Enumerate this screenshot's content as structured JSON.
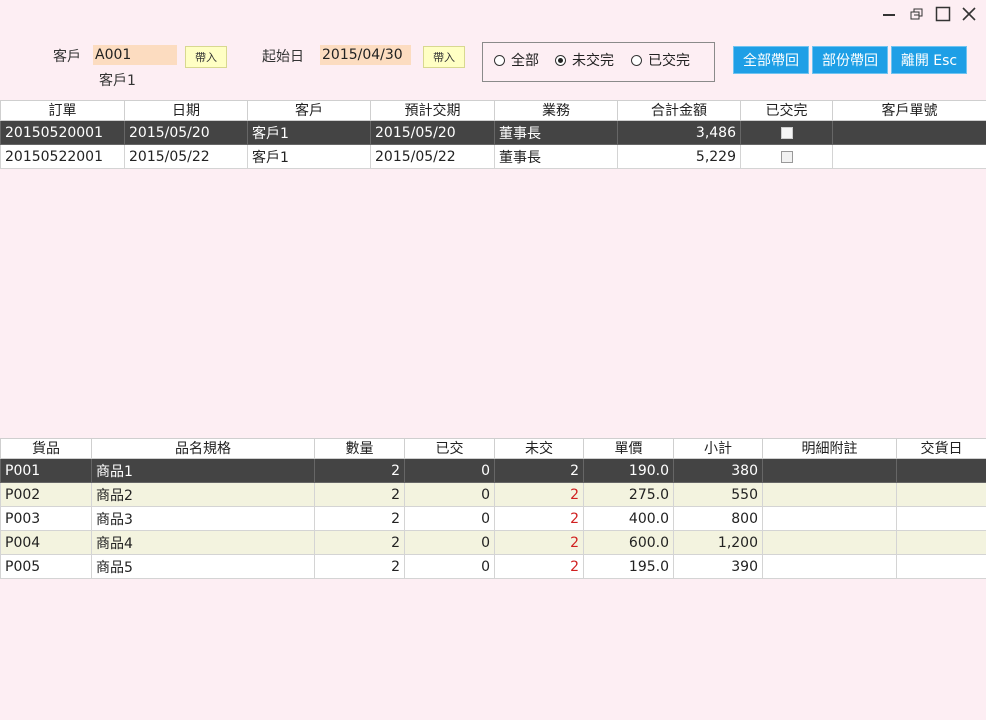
{
  "window": {
    "minimize_icon": "minimize-icon",
    "restore_icon": "restore-icon",
    "maximize_icon": "maximize-icon",
    "close_icon": "close-icon"
  },
  "filter": {
    "customer_label": "客戶",
    "customer_code": "A001",
    "customer_name": "客戶1",
    "import_label": "帶入",
    "start_date_label": "起始日",
    "start_date": "2015/04/30",
    "radios": [
      {
        "label": "全部",
        "selected": false
      },
      {
        "label": "未交完",
        "selected": true
      },
      {
        "label": "已交完",
        "selected": false
      }
    ]
  },
  "actions": {
    "return_all": "全部帶回",
    "return_partial": "部份帶回",
    "exit": "離開 Esc"
  },
  "orders": {
    "columns": [
      "訂單",
      "日期",
      "客戶",
      "預計交期",
      "業務",
      "合計金額",
      "已交完",
      "客戶單號"
    ],
    "rows": [
      {
        "order": "20150520001",
        "date": "2015/05/20",
        "customer": "客戶1",
        "due": "2015/05/20",
        "sales": "董事長",
        "total": "3,486",
        "done": false,
        "cust_no": ""
      },
      {
        "order": "20150522001",
        "date": "2015/05/22",
        "customer": "客戶1",
        "due": "2015/05/22",
        "sales": "董事長",
        "total": "5,229",
        "done": false,
        "cust_no": ""
      }
    ]
  },
  "details": {
    "columns": [
      "貨品",
      "品名規格",
      "數量",
      "已交",
      "未交",
      "單價",
      "小計",
      "明細附註",
      "交貨日"
    ],
    "rows": [
      {
        "code": "P001",
        "name": "商品1",
        "qty": "2",
        "delivered": "0",
        "pending": "2",
        "price": "190.0",
        "subtotal": "380",
        "note": "",
        "date": ""
      },
      {
        "code": "P002",
        "name": "商品2",
        "qty": "2",
        "delivered": "0",
        "pending": "2",
        "price": "275.0",
        "subtotal": "550",
        "note": "",
        "date": ""
      },
      {
        "code": "P003",
        "name": "商品3",
        "qty": "2",
        "delivered": "0",
        "pending": "2",
        "price": "400.0",
        "subtotal": "800",
        "note": "",
        "date": ""
      },
      {
        "code": "P004",
        "name": "商品4",
        "qty": "2",
        "delivered": "0",
        "pending": "2",
        "price": "600.0",
        "subtotal": "1,200",
        "note": "",
        "date": ""
      },
      {
        "code": "P005",
        "name": "商品5",
        "qty": "2",
        "delivered": "0",
        "pending": "2",
        "price": "195.0",
        "subtotal": "390",
        "note": "",
        "date": ""
      }
    ]
  }
}
